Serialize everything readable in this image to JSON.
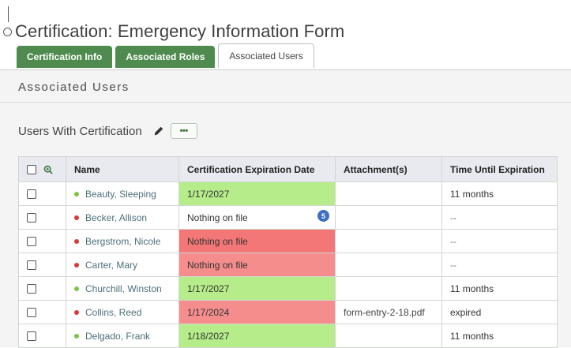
{
  "page": {
    "title": "Certification: Emergency Information Form"
  },
  "tabs": [
    {
      "label": "Certification Info",
      "active": false
    },
    {
      "label": "Associated Roles",
      "active": false
    },
    {
      "label": "Associated Users",
      "active": true
    }
  ],
  "section": {
    "title": "Associated Users",
    "subtitle": "Users With Certification",
    "more_label": "•••"
  },
  "table": {
    "headers": [
      "",
      "Name",
      "Certification Expiration Date",
      "Attachment(s)",
      "Time Until Expiration"
    ],
    "rows": [
      {
        "status": "active",
        "name": "Beauty, Sleeping",
        "date": "1/17/2027",
        "date_color": "green",
        "badge": "",
        "attachment": "",
        "time": "11 months"
      },
      {
        "status": "inactive",
        "name": "Becker, Allison",
        "date": "Nothing on file",
        "date_color": "white",
        "badge": "5",
        "attachment": "",
        "time": "--"
      },
      {
        "status": "inactive",
        "name": "Bergstrom, Nicole",
        "date": "Nothing on file",
        "date_color": "red-strong",
        "badge": "",
        "attachment": "",
        "time": "--"
      },
      {
        "status": "inactive",
        "name": "Carter, Mary",
        "date": "Nothing on file",
        "date_color": "red",
        "badge": "",
        "attachment": "",
        "time": "--"
      },
      {
        "status": "active",
        "name": "Churchill, Winston",
        "date": "1/17/2027",
        "date_color": "green",
        "badge": "",
        "attachment": "",
        "time": "11 months"
      },
      {
        "status": "inactive",
        "name": "Collins, Reed",
        "date": "1/17/2024",
        "date_color": "red",
        "badge": "",
        "attachment": "form-entry-2-18.pdf",
        "time": "expired"
      },
      {
        "status": "active",
        "name": "Delgado, Frank",
        "date": "1/18/2027",
        "date_color": "green",
        "badge": "",
        "attachment": "",
        "time": "11 months"
      }
    ]
  },
  "colors": {
    "tab_green": "#4f8a4f",
    "date_green": "#b6ec8a",
    "date_red": "#f58d8d",
    "status_green": "#7cc34a",
    "status_red": "#d63a3a",
    "badge_blue": "#3e6ec4"
  }
}
